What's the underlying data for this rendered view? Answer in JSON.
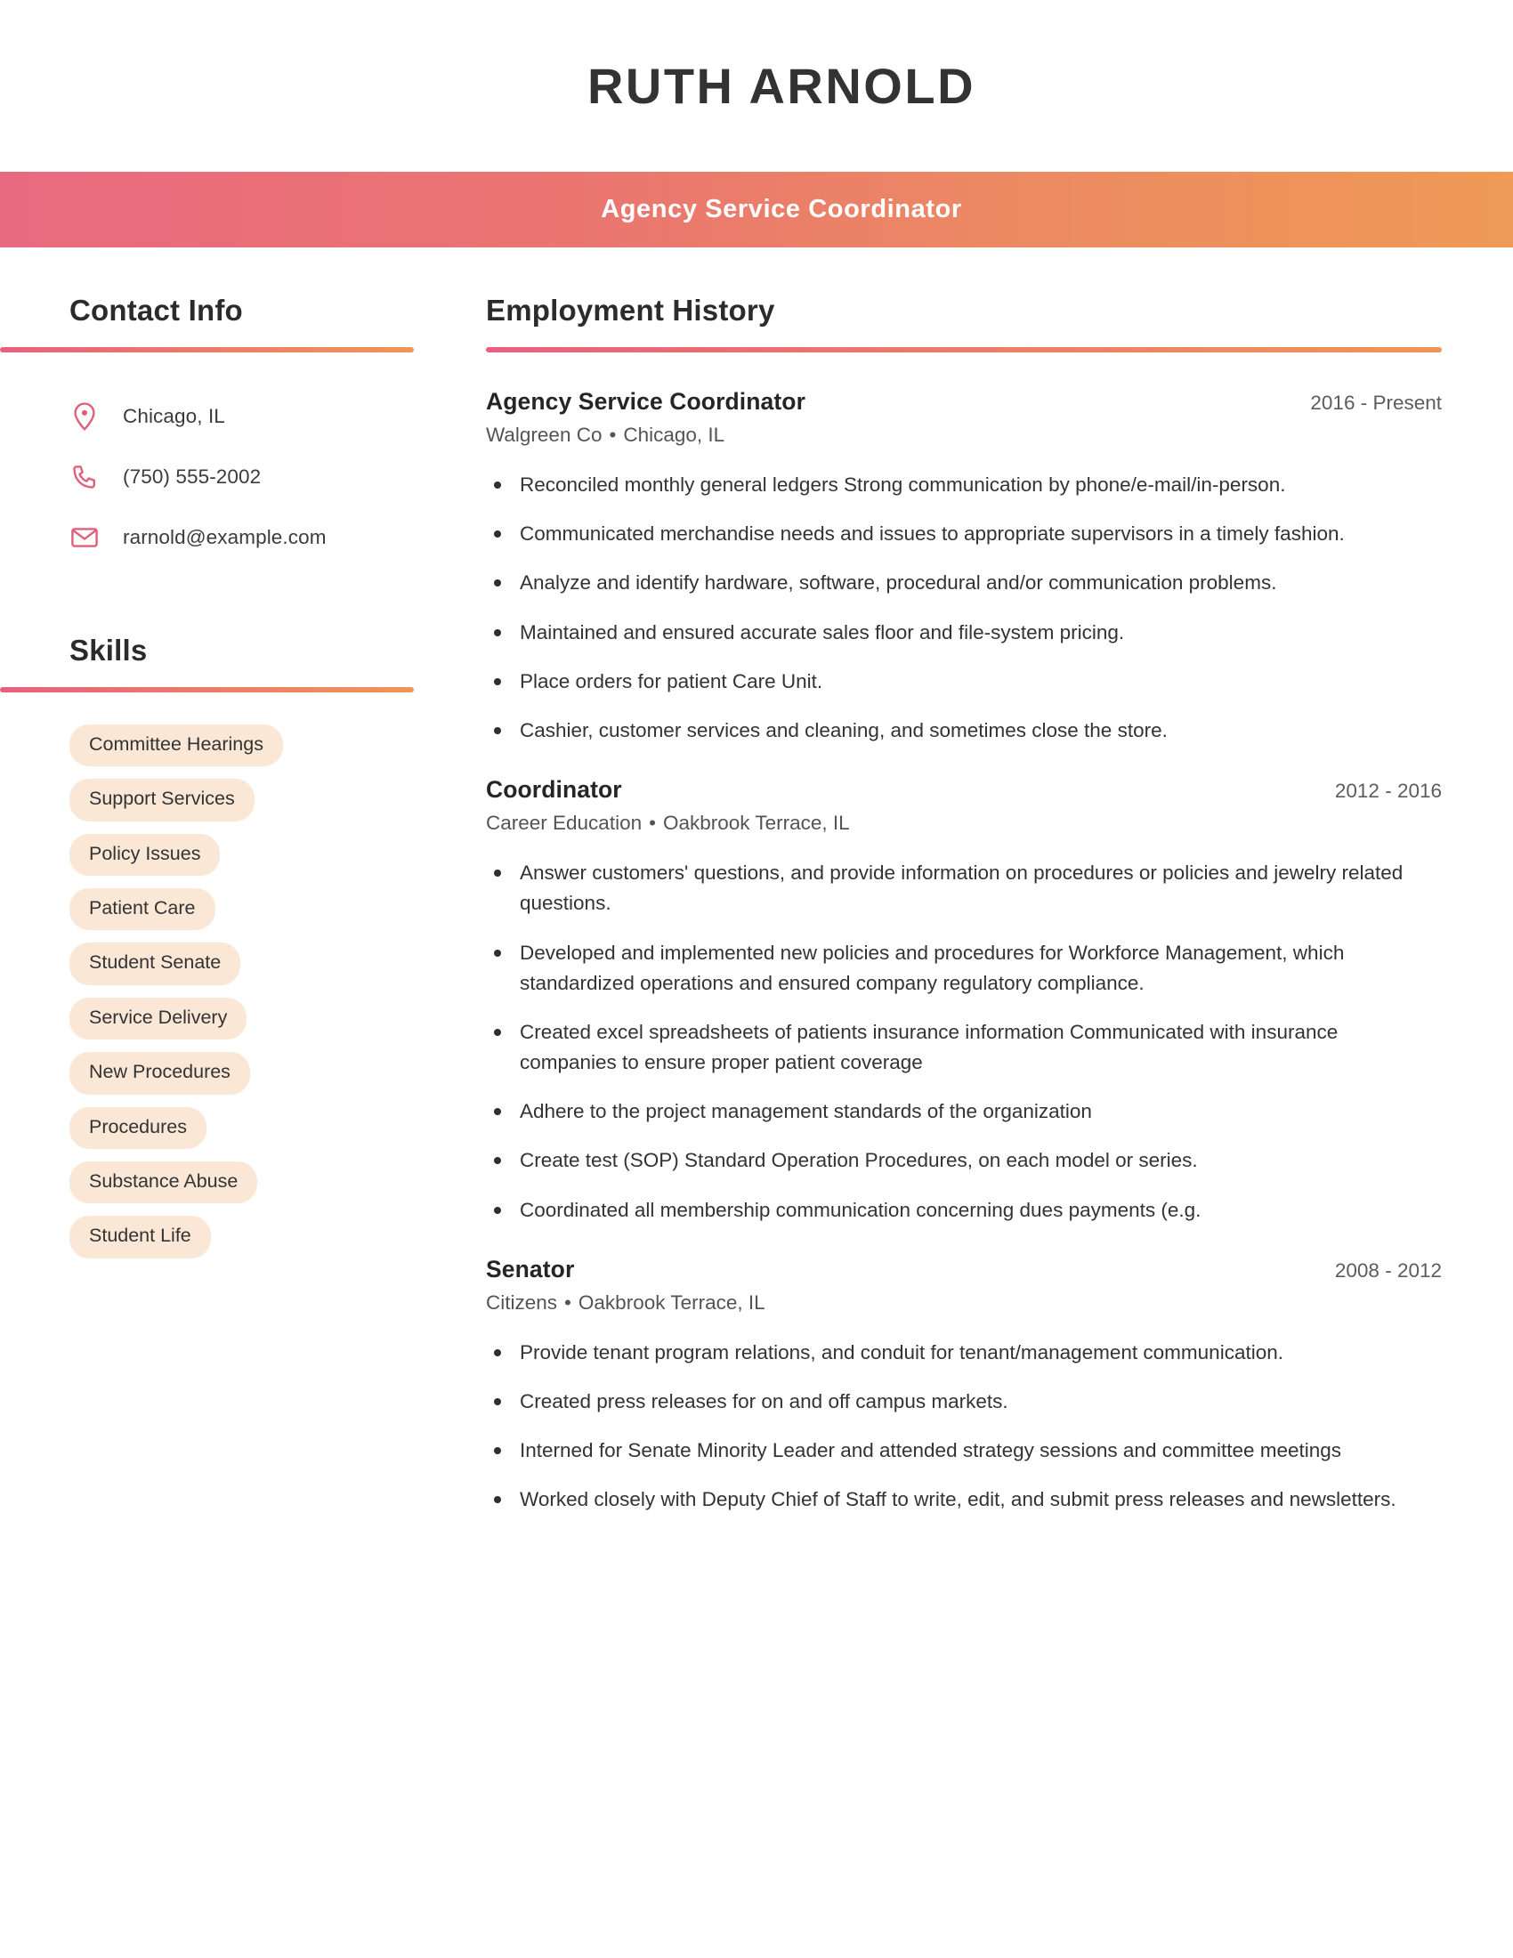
{
  "theme": {
    "accent_pink": "#E8607D",
    "accent_orange": "#EE9657",
    "pill_bg": "#FAE7D6",
    "text_dark": "#2E2E2E"
  },
  "header": {
    "name": "RUTH ARNOLD",
    "role": "Agency Service Coordinator"
  },
  "sidebar": {
    "contact": {
      "title": "Contact Info",
      "items": [
        {
          "icon": "location-pin-icon",
          "value": "Chicago, IL"
        },
        {
          "icon": "phone-icon",
          "value": "(750) 555-2002"
        },
        {
          "icon": "envelope-icon",
          "value": "rarnold@example.com"
        }
      ]
    },
    "skills": {
      "title": "Skills",
      "items": [
        "Committee Hearings",
        "Support Services",
        "Policy Issues",
        "Patient Care",
        "Student Senate",
        "Service Delivery",
        "New Procedures",
        "Procedures",
        "Substance Abuse",
        "Student Life"
      ]
    }
  },
  "main": {
    "employment": {
      "title": "Employment History",
      "jobs": [
        {
          "title": "Agency Service Coordinator",
          "dates": "2016 - Present",
          "company": "Walgreen Co",
          "location": "Chicago, IL",
          "separator": "•",
          "bullets": [
            "Reconciled monthly general ledgers Strong communication by phone/e-mail/in-person.",
            "Communicated merchandise needs and issues to appropriate supervisors in a timely fashion.",
            "Analyze and identify hardware, software, procedural and/or communication problems.",
            "Maintained and ensured accurate sales floor and file-system pricing.",
            "Place orders for patient Care Unit.",
            "Cashier, customer services and cleaning, and sometimes close the store."
          ]
        },
        {
          "title": "Coordinator",
          "dates": "2012 - 2016",
          "company": "Career Education",
          "location": "Oakbrook Terrace, IL",
          "separator": "•",
          "bullets": [
            "Answer customers' questions, and provide information on procedures or policies and jewelry related questions.",
            "Developed and implemented new policies and procedures for Workforce Management, which standardized operations and ensured company regulatory compliance.",
            "Created excel spreadsheets of patients insurance information Communicated with insurance companies to ensure proper patient coverage",
            "Adhere to the project management standards of the organization",
            "Create test (SOP) Standard Operation Procedures, on each model or series.",
            "Coordinated all membership communication concerning dues payments (e.g."
          ]
        },
        {
          "title": "Senator",
          "dates": "2008 - 2012",
          "company": "Citizens",
          "location": "Oakbrook Terrace, IL",
          "separator": "•",
          "bullets": [
            "Provide tenant program relations, and conduit for tenant/management communication.",
            "Created press releases for on and off campus markets.",
            "Interned for Senate Minority Leader and attended strategy sessions and committee meetings",
            "Worked closely with Deputy Chief of Staff to write, edit, and submit press releases and newsletters."
          ]
        }
      ]
    }
  }
}
